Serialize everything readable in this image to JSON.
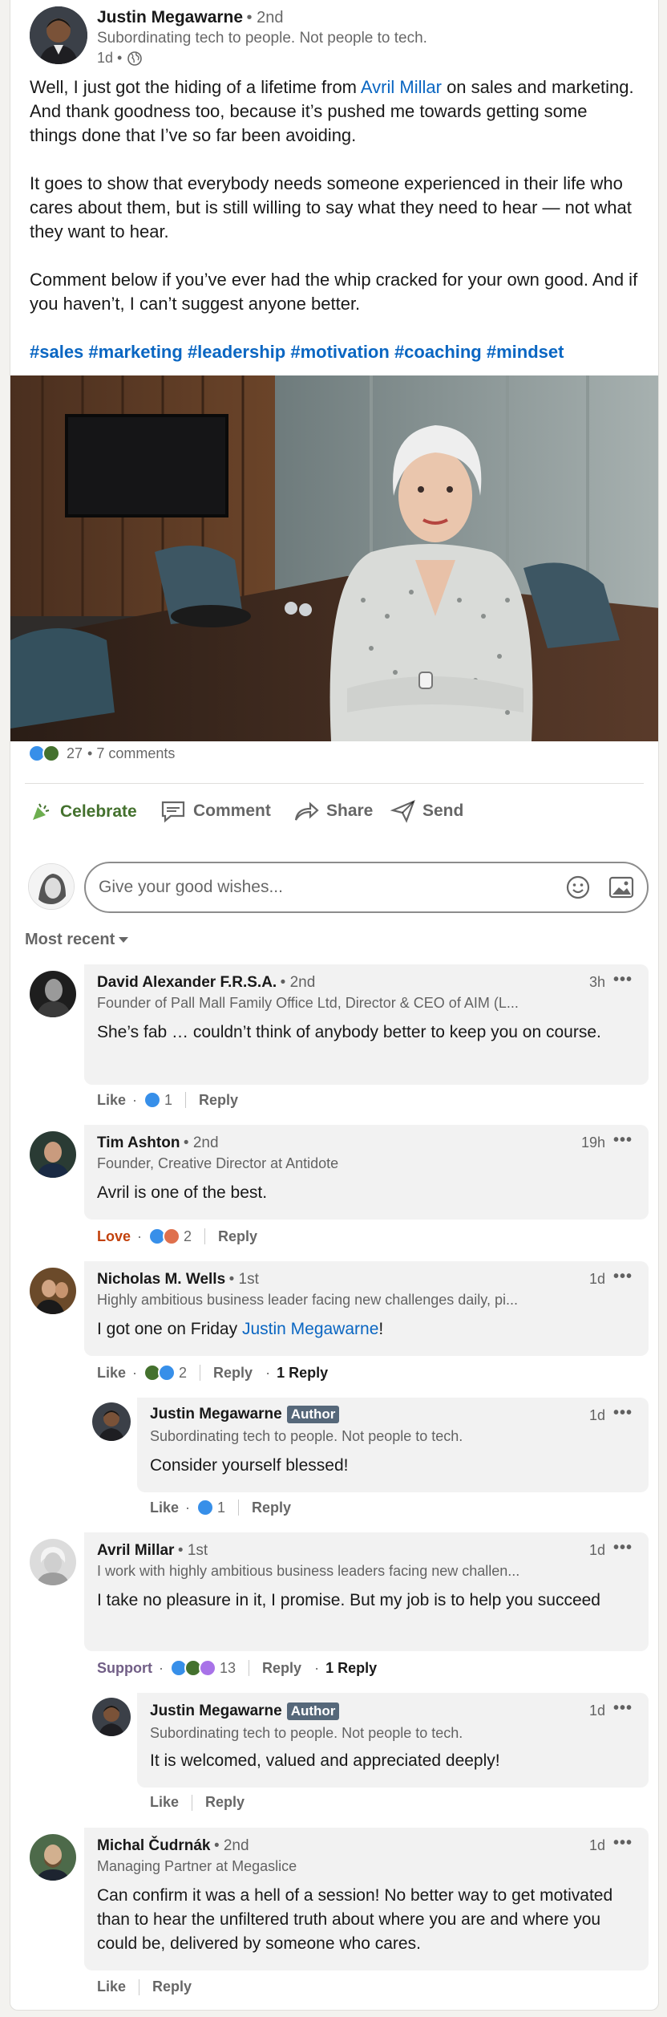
{
  "post": {
    "author": {
      "name": "Justin Megawarne",
      "degree": "• 2nd",
      "headline": "Subordinating tech to people. Not people to tech.",
      "time": "1d •"
    },
    "text": {
      "p1_a": "Well, I just got the hiding of a lifetime from ",
      "p1_mention": "Avril Millar",
      "p1_b": " on sales and marketing. And thank goodness too, because it’s pushed me towards getting some things done that I’ve so far been avoiding.",
      "p2": "It goes to show that everybody needs someone experienced in their life who cares about them, but is still willing to say what they need to hear — not what they want to hear.",
      "p3": "Comment below if you’ve ever had the whip cracked for your own good. And if you haven’t, I can’t suggest anyone better."
    },
    "hashtags": [
      "#sales",
      "#marketing",
      "#leadership",
      "#motivation",
      "#coaching",
      "#mindset"
    ],
    "social": {
      "reaction_count": "27",
      "comments": "• 7 comments"
    },
    "actions": {
      "celebrate": "Celebrate",
      "comment": "Comment",
      "share": "Share",
      "send": "Send"
    },
    "comment_box": {
      "placeholder": "Give your good wishes..."
    },
    "sort": {
      "label": "Most recent"
    }
  },
  "comments": [
    {
      "name": "David Alexander F.R.S.A.",
      "degree": "• 2nd",
      "headline": "Founder of Pall Mall Family Office Ltd, Director & CEO of AIM (L...",
      "time": "3h",
      "text": "She’s fab … couldn’t think of anybody better to keep you on course.",
      "reaction_label": "Like",
      "reaction_count": "1",
      "reply": "Reply"
    },
    {
      "name": "Tim Ashton",
      "degree": "• 2nd",
      "headline": "Founder, Creative Director at Antidote",
      "time": "19h",
      "text": "Avril is one of the best.",
      "reaction_label": "Love",
      "reaction_count": "2",
      "reply": "Reply"
    },
    {
      "name": "Nicholas M. Wells",
      "degree": "• 1st",
      "headline": "Highly ambitious business leader facing new challenges daily, pi...",
      "time": "1d",
      "text_a": "I got one on Friday ",
      "text_mention": "Justin Megawarne",
      "text_b": "!",
      "reaction_label": "Like",
      "reaction_count": "2",
      "reply": "Reply",
      "replies_count": "1 Reply"
    },
    {
      "name": "Justin Megawarne",
      "badge": "Author",
      "headline": "Subordinating tech to people. Not people to tech.",
      "time": "1d",
      "text": "Consider yourself blessed!",
      "reaction_label": "Like",
      "reaction_count": "1",
      "reply": "Reply"
    },
    {
      "name": "Avril Millar",
      "degree": "• 1st",
      "headline": "I work with highly ambitious business leaders facing new challen...",
      "time": "1d",
      "text": "I take no pleasure in it, I promise. But my job is to help you succeed",
      "reaction_label": "Support",
      "reaction_count": "13",
      "reply": "Reply",
      "replies_count": "1 Reply"
    },
    {
      "name": "Justin Megawarne",
      "badge": "Author",
      "headline": "Subordinating tech to people. Not people to tech.",
      "time": "1d",
      "text": "It is welcomed, valued and appreciated deeply!",
      "reaction_label": "Like",
      "reply": "Reply"
    },
    {
      "name": "Michal Čudrnák",
      "degree": "• 2nd",
      "headline": "Managing Partner at Megaslice",
      "time": "1d",
      "text": "Can confirm it was a hell of a session! No better way to get motivated than to hear the unfiltered truth about where you are and where you could be, delivered by someone who cares.",
      "reaction_label": "Like",
      "reply": "Reply"
    }
  ],
  "icons": {
    "visibility": "globe-icon",
    "more": "more-dots-icon",
    "emoji": "emoji-icon",
    "image": "image-icon",
    "sort": "caret-down-icon"
  },
  "colors": {
    "link": "#0a66c2",
    "like": "#378fe9",
    "celebrate": "#44712e",
    "love": "#df704d",
    "support": "#a872e8",
    "badge": "#56687a"
  }
}
